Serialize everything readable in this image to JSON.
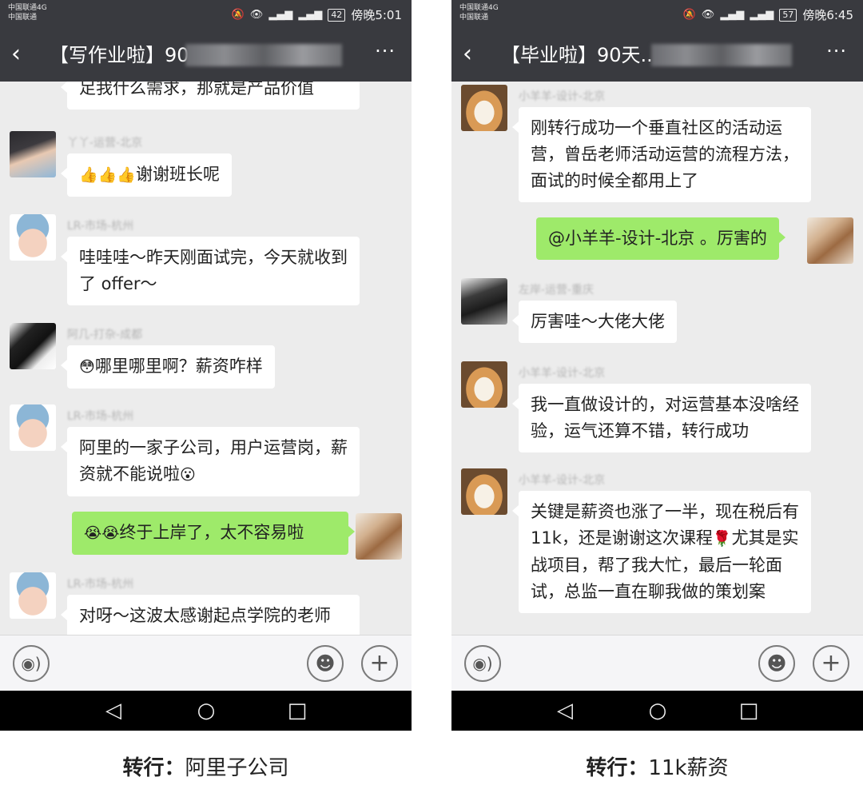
{
  "left": {
    "status": {
      "carrier1": "中国联通4G",
      "carrier2": "中国联通",
      "battery": "42",
      "time": "傍晚5:01"
    },
    "title": "【写作业啦】90",
    "messages": {
      "m0": {
        "text": "足我什么需求，那就是产品价值"
      },
      "m1": {
        "sender": "丫丫-运营-北京",
        "text": "谢谢班长呢",
        "emoji": "👍👍👍"
      },
      "m2": {
        "sender": "LR-市场-杭州",
        "text": "哇哇哇～昨天刚面试完，今天就收到了 offer～"
      },
      "m3": {
        "sender": "阿几-打杂-成都",
        "emoji": "😳",
        "text": "哪里哪里啊？薪资咋样"
      },
      "m4": {
        "sender": "LR-市场-杭州",
        "text": "阿里的一家子公司，用户运营岗，薪资就不能说啦",
        "emoji": "😮"
      },
      "m5": {
        "emoji": "😭😭",
        "text": "终于上岸了，太不容易啦"
      },
      "m6": {
        "sender": "LR-市场-杭州",
        "text": "对呀～这波太感谢起点学院的老师"
      }
    },
    "caption": {
      "label": "转行：",
      "value": "阿里子公司"
    }
  },
  "right": {
    "status": {
      "carrier1": "中国联通4G",
      "carrier2": "中国联通",
      "battery": "57",
      "time": "傍晚6:45"
    },
    "title": "【毕业啦】90天..",
    "messages": {
      "m1": {
        "sender": "小羊羊-设计-北京",
        "text": "刚转行成功一个垂直社区的活动运营，曾岳老师活动运营的流程方法，面试的时候全都用上了"
      },
      "m2": {
        "text": "@小羊羊-设计-北京 。厉害的"
      },
      "m3": {
        "sender": "左岸-运营-重庆",
        "text": "厉害哇～大佬大佬"
      },
      "m4": {
        "sender": "小羊羊-设计-北京",
        "text": "我一直做设计的，对运营基本没啥经验，运气还算不错，转行成功"
      },
      "m5": {
        "sender": "小羊羊-设计-北京",
        "text_a": "关键是薪资也涨了一半，现在税后有11k，还是谢谢这次课程",
        "emoji": "🌹",
        "text_b": "尤其是实战项目，帮了我大忙，最后一轮面试，总监一直在聊我做的策划案"
      }
    },
    "caption": {
      "label": "转行：",
      "value": "11k薪资"
    }
  },
  "icons": {
    "back": "chevron-left-icon",
    "more": "more-dots-icon",
    "voice": "voice-icon",
    "emoji": "smiley-icon",
    "plus": "plus-icon",
    "nav_back": "triangle-back-icon",
    "nav_home": "circle-home-icon",
    "nav_recent": "square-recent-icon"
  },
  "colors": {
    "titlebar": "#393a3f",
    "chat_bg": "#ececec",
    "bubble_mine": "#9eea6a",
    "bubble_other": "#ffffff"
  }
}
